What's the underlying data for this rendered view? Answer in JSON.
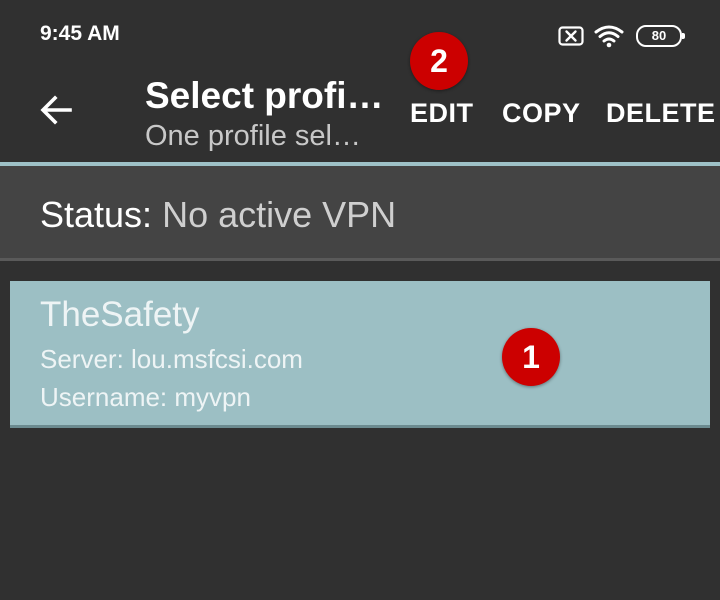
{
  "status_bar": {
    "time": "9:45 AM",
    "battery": "80",
    "icons": [
      "notification-x-icon",
      "wifi-icon",
      "battery-icon"
    ]
  },
  "toolbar": {
    "back_icon": "arrow-left-icon",
    "title": "Select profi…",
    "subtitle": "One profile sel…",
    "actions": {
      "edit": "EDIT",
      "copy": "COPY",
      "delete": "DELETE"
    }
  },
  "status": {
    "label": "Status:",
    "value": "No active VPN"
  },
  "profiles": [
    {
      "name": "TheSafety",
      "server": "Server: lou.msfcsi.com",
      "username": "Username: myvpn",
      "selected": true
    }
  ],
  "markers": {
    "one": "1",
    "two": "2"
  },
  "colors": {
    "background": "#303030",
    "status_row": "#444444",
    "accent": "#9ec1c7",
    "selected_card": "#9cbfc4",
    "marker": "#cc0000"
  }
}
